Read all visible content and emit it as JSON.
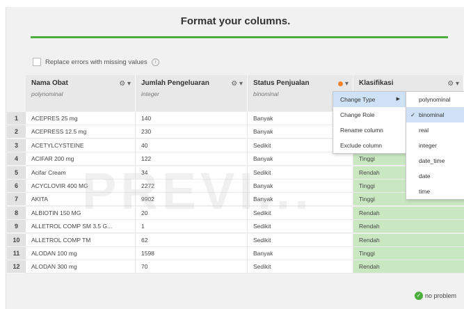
{
  "title": "Format your columns.",
  "replace_errors_label": "Replace errors with missing values",
  "columns": [
    {
      "name": "Nama Obat",
      "type": "polynominal"
    },
    {
      "name": "Jumlah Pengeluaran",
      "type": "integer"
    },
    {
      "name": "Status Penjualan",
      "type": "binominal"
    },
    {
      "name": "Klasifikasi",
      "type": ""
    }
  ],
  "rows": [
    {
      "num": "1",
      "cells": [
        "ACEPRES 25 mg",
        "140",
        "Banyak",
        ""
      ]
    },
    {
      "num": "2",
      "cells": [
        "ACEPRESS 12.5 mg",
        "230",
        "Banyak",
        ""
      ]
    },
    {
      "num": "3",
      "cells": [
        "ACETYLCYSTEINE",
        "40",
        "Sedikit",
        ""
      ]
    },
    {
      "num": "4",
      "cells": [
        "ACIFAR 200 mg",
        "122",
        "Banyak",
        "Tinggi"
      ]
    },
    {
      "num": "5",
      "cells": [
        "Acifar Cream",
        "34",
        "Sedikit",
        "Rendah"
      ]
    },
    {
      "num": "6",
      "cells": [
        "ACYCLOVIR 400 MG",
        "2272",
        "Banyak",
        "Tinggi"
      ]
    },
    {
      "num": "7",
      "cells": [
        "AKITA",
        "9902",
        "Banyak",
        "Tinggi"
      ]
    },
    {
      "num": "8",
      "cells": [
        "ALBIOTIN 150 MG",
        "20",
        "Sedikit",
        "Rendah"
      ]
    },
    {
      "num": "9",
      "cells": [
        "ALLETROL COMP SM 3.5 G...",
        "1",
        "Sedikit",
        "Rendah"
      ]
    },
    {
      "num": "10",
      "cells": [
        "ALLETROL COMP TM",
        "62",
        "Sedikit",
        "Rendah"
      ]
    },
    {
      "num": "11",
      "cells": [
        "ALODAN 100 mg",
        "1598",
        "Banyak",
        "Tinggi"
      ]
    },
    {
      "num": "12",
      "cells": [
        "ALODAN 300 mg",
        "70",
        "Sedikit",
        "Rendah"
      ]
    }
  ],
  "context_menu": [
    "Change Type",
    "Change Role",
    "Rename column",
    "Exclude column"
  ],
  "type_menu": [
    "polynominal",
    "binominal",
    "real",
    "integer",
    "date_time",
    "date",
    "time"
  ],
  "selected_type": "binominal",
  "watermark": "PREVI...",
  "status_text": "no problem",
  "icons": {
    "gear": "gear-icon",
    "dropdown": "chevron-down-icon",
    "check": "check-icon",
    "ok": "check-circle-icon",
    "info": "info-icon"
  },
  "colors": {
    "accent_green": "#4cae3c",
    "classification_bg": "#c9e8c2",
    "menu_highlight": "#cfe1f5",
    "warning_dot": "#f0832b"
  }
}
